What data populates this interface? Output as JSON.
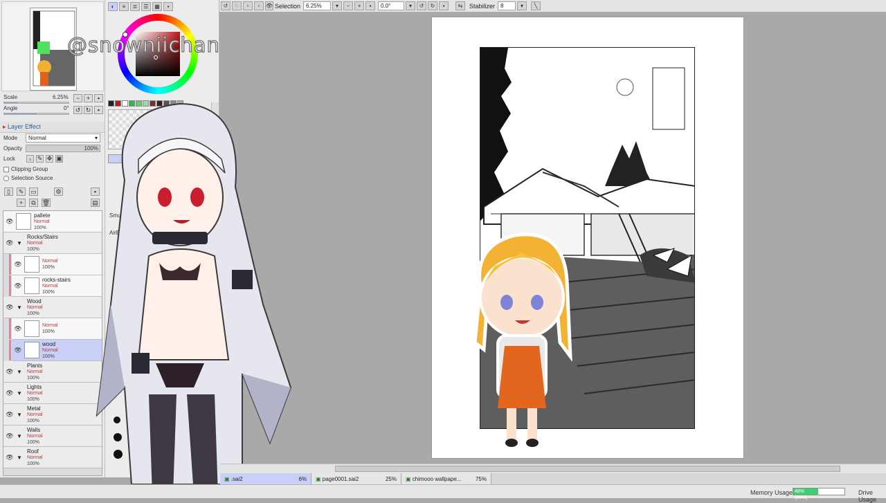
{
  "toolbar": {
    "selection_label": "Selection",
    "zoom_value": "6.25%",
    "rotation_value": "0.0°",
    "stabilizer_label": "Stabilizer",
    "stabilizer_value": "8"
  },
  "navigator": {
    "scale_label": "Scale",
    "scale_value": "6.25%",
    "angle_label": "Angle",
    "angle_value": "0°"
  },
  "layer_panel": {
    "title": "Layer Effect",
    "mode_label": "Mode",
    "mode_value": "Normal",
    "opacity_label": "Opacity",
    "opacity_value": "100%",
    "lock_label": "Lock",
    "clipping_group_label": "Clipping Group",
    "selection_source_label": "Selection Source",
    "layers": [
      {
        "name": "pallete",
        "mode": "Normal",
        "opacity": "100%",
        "folder": false,
        "child": false
      },
      {
        "name": "Rocks/Stairs",
        "mode": "Normal",
        "opacity": "100%",
        "folder": true,
        "child": false
      },
      {
        "name": "",
        "mode": "Normal",
        "opacity": "100%",
        "folder": false,
        "child": true
      },
      {
        "name": "rocks-stairs",
        "mode": "Normal",
        "opacity": "100%",
        "folder": false,
        "child": true
      },
      {
        "name": "Wood",
        "mode": "Normal",
        "opacity": "100%",
        "folder": true,
        "child": false
      },
      {
        "name": "",
        "mode": "Normal",
        "opacity": "100%",
        "folder": false,
        "child": true
      },
      {
        "name": "wood",
        "mode": "Normal",
        "opacity": "100%",
        "folder": false,
        "child": true,
        "selected": true
      },
      {
        "name": "Plants",
        "mode": "Normal",
        "opacity": "100%",
        "folder": true,
        "child": false
      },
      {
        "name": "Lights",
        "mode": "Normal",
        "opacity": "100%",
        "folder": true,
        "child": false
      },
      {
        "name": "Metal",
        "mode": "Normal",
        "opacity": "100%",
        "folder": true,
        "child": false
      },
      {
        "name": "Walls",
        "mode": "Normal",
        "opacity": "100%",
        "folder": true,
        "child": false
      },
      {
        "name": "Roof",
        "mode": "Normal",
        "opacity": "100%",
        "folder": true,
        "child": false
      }
    ]
  },
  "tool_panel": {
    "tool_labels": [
      "Smudg",
      "AirB"
    ]
  },
  "watermark": "@snowniichan",
  "doc_tabs": [
    {
      "name": ".sai2",
      "zoom": "6%",
      "active": true
    },
    {
      "name": "page0001.sai2",
      "zoom": "25%",
      "active": false
    },
    {
      "name": "chimooo wallpape...",
      "zoom": "75%",
      "active": false
    }
  ],
  "status": {
    "memory_label": "Memory Usage",
    "memory_value": "48% (56%)",
    "memory_fraction": 0.48,
    "drive_label": "Drive Usage"
  },
  "colors": {
    "accent_selected": "#c9cff7",
    "memory_fill": "#3fcf72",
    "primary_color": "#c01818"
  }
}
